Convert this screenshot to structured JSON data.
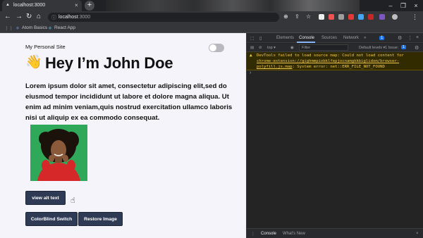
{
  "browser": {
    "tab_title": "localhost:3000",
    "url_host": "localhost",
    "url_port": ":3000",
    "bookmarks": [
      "Atom Basics",
      "React App"
    ]
  },
  "page": {
    "site_name": "My Personal Site",
    "hero_emoji": "👋",
    "hero_title": "Hey I’m John Doe",
    "intro": "Lorem ipsum dolor sit amet, consectetur adipiscing elit,sed do eiusmod tempor incididunt ut labore et dolore magna aliqua. Ut enim ad minim veniam,quis nostrud exercitation ullamco laboris nisi ut aliquip ex ea commodo consequat.",
    "dark_mode_toggle_on": false,
    "buttons": {
      "view_alt": "view alt text",
      "colorblind": "ColorBlind Switch",
      "restore": "Restore Image"
    }
  },
  "devtools": {
    "tabs": [
      "Elements",
      "Console",
      "Sources",
      "Network"
    ],
    "active_tab": "Console",
    "more_tabs": "»",
    "issue_count_badge": "1",
    "context": "top",
    "filter_placeholder": "Filter",
    "log_level": "Default levels",
    "issues_label": "1 Issue:",
    "issues_count": "1",
    "warning_text_1": "DevTools failed to load source map: Could not load content for ",
    "warning_link": "chrome-extension://gighmmpiobklfepjocnamgkkbiglidom/browser-polyfill.js.map",
    "warning_text_2": ": System error: net::ERR_FILE_NOT_FOUND",
    "prompt": "›",
    "drawer_tabs": [
      "Console",
      "What's New"
    ]
  },
  "colors": {
    "page_bg": "#f5f4fa",
    "button_bg": "#2f3b54",
    "warning_text": "#f2c94c"
  }
}
